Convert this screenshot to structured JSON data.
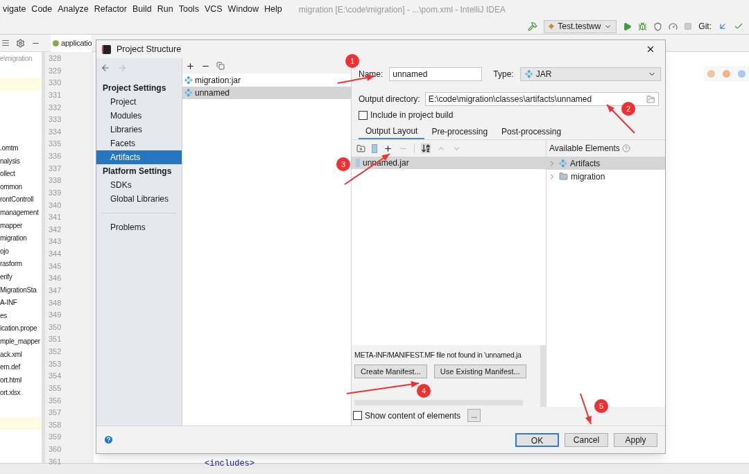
{
  "menu_bar": {
    "items": [
      "vigate",
      "Code",
      "Analyze",
      "Refactor",
      "Build",
      "Run",
      "Tools",
      "VCS",
      "Window",
      "Help"
    ],
    "title": "migration [E:\\code\\migration] - ...\\pom.xml - IntelliJ IDEA"
  },
  "toolbar": {
    "run_config": "Test.testww",
    "git_label": "Git:"
  },
  "tool_window": {
    "tab": "applicatio"
  },
  "project_tree": {
    "path": "e\\migration",
    "items": [
      ".omtm",
      "nalysis",
      "ollect",
      "ommon",
      "rontControll",
      "management",
      "mapper",
      "migration",
      "ojo",
      "rasform",
      "erify",
      "MigrationSta",
      "A-INF",
      "es",
      "ication.prope",
      "mple_mapper",
      "ack.xml",
      "ern.def",
      "ort.html",
      "ort.xlsx"
    ]
  },
  "editor": {
    "line_numbers": [
      "328",
      "329",
      "330",
      "331",
      "332",
      "333",
      "334",
      "335",
      "336",
      "337",
      "338",
      "339",
      "340",
      "341",
      "342",
      "343",
      "344",
      "345",
      "346",
      "347",
      "348",
      "349",
      "350",
      "351",
      "352",
      "353",
      "354",
      "355",
      "356",
      "357",
      "358",
      "359",
      "360",
      "361"
    ],
    "code_fragment": "<includes>"
  },
  "dialog": {
    "title": "Project Structure",
    "sidebar": {
      "sections": [
        {
          "heading": "Project Settings",
          "items": [
            {
              "label": "Project",
              "selected": false
            },
            {
              "label": "Modules",
              "selected": false
            },
            {
              "label": "Libraries",
              "selected": false
            },
            {
              "label": "Facets",
              "selected": false
            },
            {
              "label": "Artifacts",
              "selected": true
            }
          ]
        },
        {
          "heading": "Platform Settings",
          "items": [
            {
              "label": "SDKs",
              "selected": false
            },
            {
              "label": "Global Libraries",
              "selected": false
            }
          ]
        }
      ],
      "problems": "Problems"
    },
    "artifacts": [
      {
        "label": "migration:jar",
        "selected": false
      },
      {
        "label": "unnamed",
        "selected": true
      }
    ],
    "name_label": "Name:",
    "name_value": "unnamed",
    "type_label": "Type:",
    "type_value": "JAR",
    "output_label": "Output directory:",
    "output_value": "E:\\code\\migration\\classes\\artifacts\\unnamed",
    "include_in_build": {
      "label": "Include in project build",
      "checked": false
    },
    "tabs": [
      {
        "label": "Output Layout",
        "selected": true
      },
      {
        "label": "Pre-processing",
        "selected": false
      },
      {
        "label": "Post-processing",
        "selected": false
      }
    ],
    "layout_tree": [
      {
        "label": "unnamed.jar",
        "selected": true
      }
    ],
    "available_label": "Available Elements",
    "available": [
      {
        "label": "Artifacts",
        "selected": true,
        "kind": "artifact"
      },
      {
        "label": "migration",
        "selected": false,
        "kind": "module"
      }
    ],
    "manifest_message": "META-INF/MANIFEST.MF file not found in 'unnamed.ja",
    "manifest_buttons": [
      "Create Manifest...",
      "Use Existing Manifest..."
    ],
    "show_content": {
      "label": "Show content of elements",
      "checked": false
    },
    "more_button": "...",
    "buttons": [
      {
        "label": "OK",
        "kind": "default"
      },
      {
        "label": "Cancel",
        "kind": "normal"
      },
      {
        "label": "Apply",
        "kind": "normal"
      }
    ]
  },
  "annotations": [
    "1",
    "2",
    "3",
    "4",
    "5"
  ]
}
